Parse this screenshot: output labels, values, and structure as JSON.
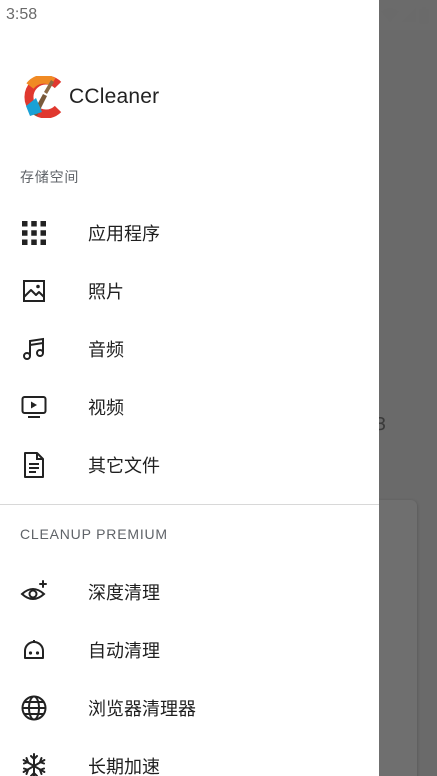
{
  "status_bar": {
    "time": "3:58"
  },
  "app": {
    "name": "CCleaner"
  },
  "sections": {
    "storage": {
      "title": "存储空间",
      "items": [
        {
          "label": "应用程序",
          "icon": "apps-grid-icon"
        },
        {
          "label": "照片",
          "icon": "image-icon"
        },
        {
          "label": "音频",
          "icon": "music-note-icon"
        },
        {
          "label": "视频",
          "icon": "video-icon"
        },
        {
          "label": "其它文件",
          "icon": "document-icon"
        }
      ]
    },
    "premium": {
      "title": "CLEANUP PREMIUM",
      "items": [
        {
          "label": "深度清理",
          "icon": "eye-sparkle-icon"
        },
        {
          "label": "自动清理",
          "icon": "robot-icon"
        },
        {
          "label": "浏览器清理器",
          "icon": "globe-icon"
        },
        {
          "label": "长期加速",
          "icon": "snowflake-icon"
        }
      ]
    }
  },
  "colors": {
    "drawer_bg": "#ffffff",
    "scrim": "#6b6b6b",
    "text": "#1f1f1f",
    "section_header": "#5f6368"
  }
}
